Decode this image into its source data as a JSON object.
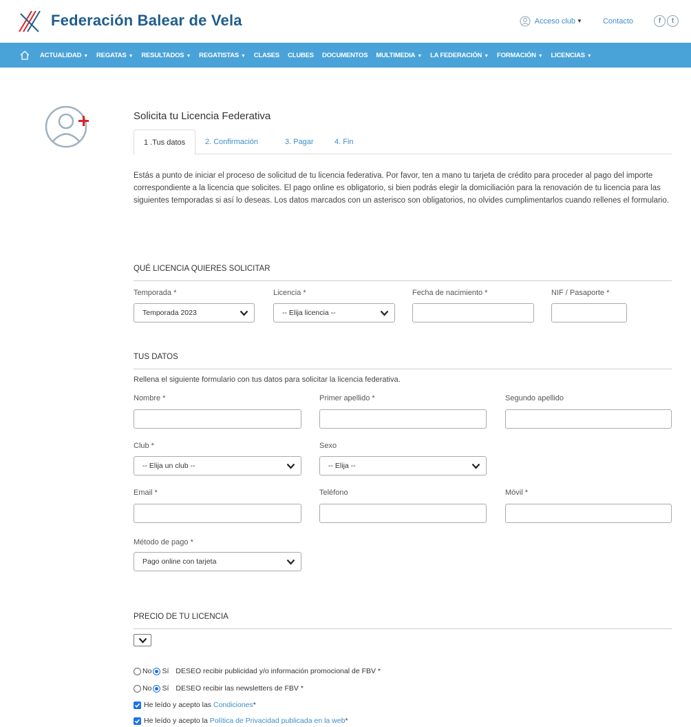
{
  "header": {
    "site_title": "Federación Balear de Vela",
    "acceso_club": "Acceso club",
    "contacto": "Contacto",
    "social": [
      "f",
      "t"
    ]
  },
  "nav": {
    "items": [
      {
        "label": "ACTUALIDAD",
        "dropdown": true
      },
      {
        "label": "REGATAS",
        "dropdown": true
      },
      {
        "label": "RESULTADOS",
        "dropdown": true
      },
      {
        "label": "REGATISTAS",
        "dropdown": true
      },
      {
        "label": "CLASES",
        "dropdown": false
      },
      {
        "label": "CLUBES",
        "dropdown": false
      },
      {
        "label": "DOCUMENTOS",
        "dropdown": false
      },
      {
        "label": "MULTIMEDIA",
        "dropdown": true
      },
      {
        "label": "LA FEDERACIÓN",
        "dropdown": true
      },
      {
        "label": "FORMACIÓN",
        "dropdown": true
      },
      {
        "label": "LICENCIAS",
        "dropdown": true
      }
    ]
  },
  "page": {
    "title": "Solicita tu Licencia Federativa",
    "tabs": [
      "1 .Tus datos",
      "2. Confirmación",
      "3. Pagar",
      "4. Fin"
    ],
    "intro": "Estás a punto de iniciar el proceso de solicitud de tu licencia federativa. Por favor, ten a mano tu tarjeta de crédito para proceder al pago del importe correspondiente a la licencia que solicites. El pago online es obligatorio, si bien podrás elegir la domiciliación para la renovación de tu licencia para las siguientes temporadas si así lo deseas. Los datos marcados con un asterisco son obligatorios, no olvides cumplimentarlos cuando rellenes el formulario."
  },
  "licencia_section": {
    "title": "QUÉ LICENCIA QUIERES SOLICITAR",
    "temporada_label": "Temporada *",
    "temporada_value": "Temporada 2023",
    "licencia_label": "Licencia *",
    "licencia_value": "-- Elija licencia --",
    "fecha_label": "Fecha de nacimiento *",
    "fecha_value": "",
    "nif_label": "NIF / Pasaporte *",
    "nif_value": ""
  },
  "datos_section": {
    "title": "TUS DATOS",
    "help": "Rellena el siguiente formulario con tus datos para solicitar la licencia federativa.",
    "nombre_label": "Nombre *",
    "apellido1_label": "Primer apellido *",
    "apellido2_label": "Segundo apellido",
    "club_label": "Club *",
    "club_value": "-- Elija un club --",
    "sexo_label": "Sexo",
    "sexo_value": "-- Elija --",
    "email_label": "Email *",
    "telefono_label": "Teléfono",
    "movil_label": "Móvil *",
    "pago_label": "Método de pago *",
    "pago_value": "Pago online con tarjeta"
  },
  "precio_section": {
    "title": "PRECIO DE TU LICENCIA"
  },
  "consent": {
    "no": "No",
    "si": "Sí",
    "publicidad": "DESEO recibir publicidad y/o información promocional de FBV *",
    "newsletter": "DESEO recibir las newsletters de FBV *",
    "condiciones_prefix": "He leído y acepto las",
    "condiciones_link": "Condiciones",
    "condiciones_suffix": " *",
    "privacidad_prefix": "He leído y acepto la",
    "privacidad_link": "Política de Privacidad publicada en la web",
    "privacidad_suffix": " *"
  },
  "colors": {
    "nav_bg": "#4aa3d8",
    "title_blue": "#1f5d8c",
    "link_blue": "#3d8ec8",
    "accent_red": "#d8232a"
  }
}
